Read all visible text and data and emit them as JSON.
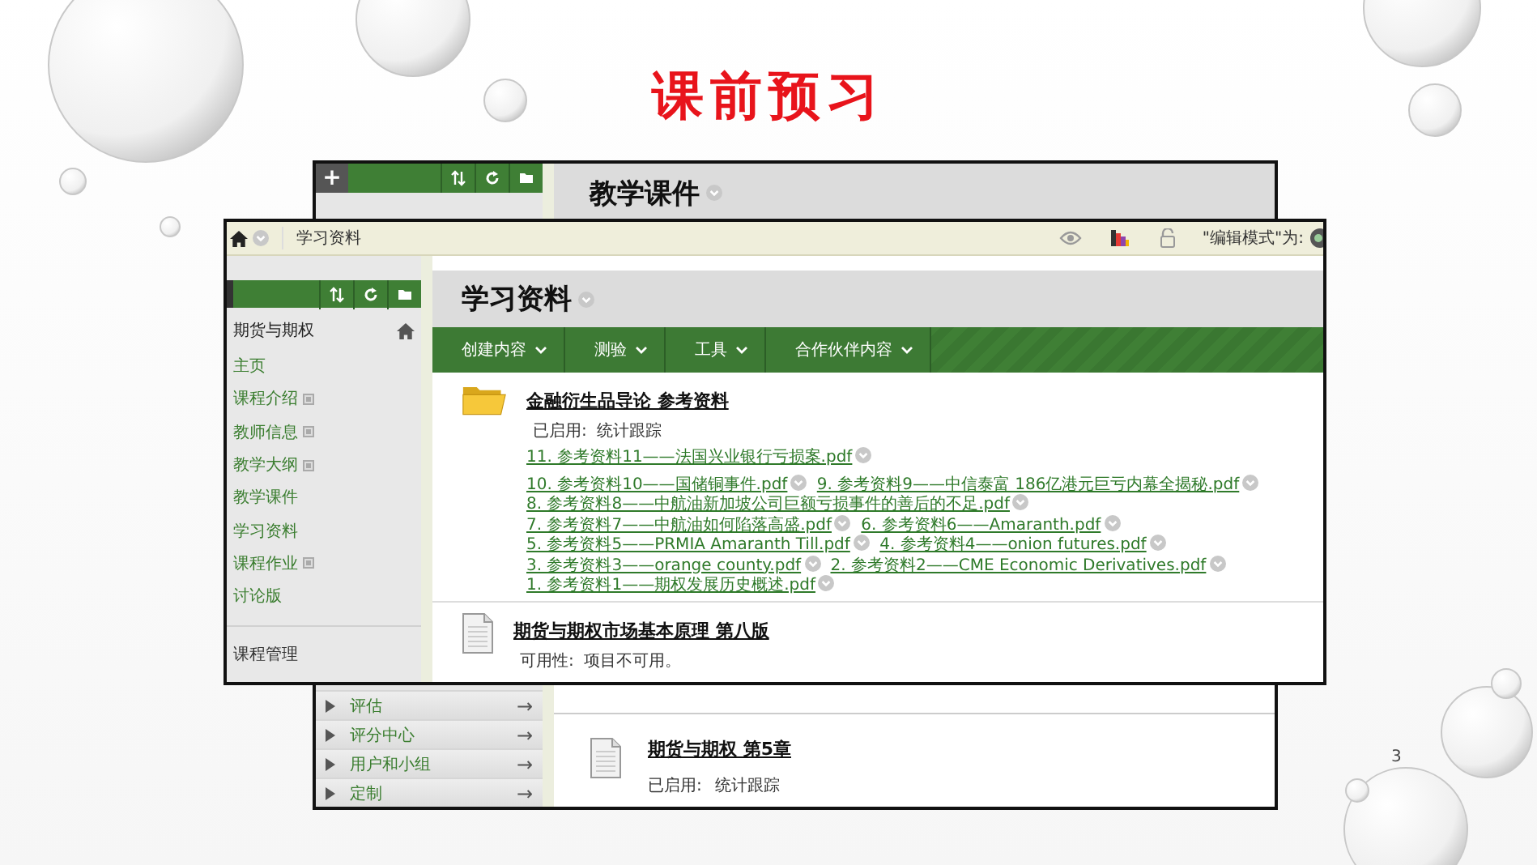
{
  "slide": {
    "title": "课前预习",
    "page_number": "3"
  },
  "back_window": {
    "add_button": "+",
    "page_title": "教学课件",
    "menu_items": [
      {
        "label": "评估",
        "arrow": "→"
      },
      {
        "label": "评分中心",
        "arrow": "→"
      },
      {
        "label": "用户和小组",
        "arrow": "→"
      },
      {
        "label": "定制",
        "arrow": "→"
      }
    ],
    "content_item": {
      "title": "期货与期权 第5章",
      "status_label": "已启用:",
      "status_value": "统计跟踪"
    }
  },
  "front_window": {
    "breadcrumb": "学习资料",
    "edit_mode_label": "\"编辑模式\"为:",
    "course_title": "期货与期权",
    "nav_items": [
      {
        "label": "主页",
        "hidden": false
      },
      {
        "label": "课程介绍",
        "hidden": true
      },
      {
        "label": "教师信息",
        "hidden": true
      },
      {
        "label": "教学大纲",
        "hidden": true
      },
      {
        "label": "教学课件",
        "hidden": false
      },
      {
        "label": "学习资料",
        "hidden": false
      },
      {
        "label": "课程作业",
        "hidden": true
      },
      {
        "label": "讨论版",
        "hidden": false
      }
    ],
    "admin_label": "课程管理",
    "page_title": "学习资料",
    "action_tabs": [
      "创建内容",
      "测验",
      "工具",
      "合作伙伴内容"
    ],
    "content_items": [
      {
        "kind": "folder",
        "title": "金融衍生品导论 参考资料",
        "status_label": "已启用:",
        "status_value": "统计跟踪",
        "link_groups": [
          [
            "11. 参考资料11——法国兴业银行亏损案.pdf"
          ],
          [
            "10. 参考资料10——国储铜事件.pdf",
            "9. 参考资料9——中信泰富 186亿港元巨亏内幕全揭秘.pdf",
            "8. 参考资料8——中航油新加坡公司巨额亏损事件的善后的不足.pdf",
            "7. 参考资料7——中航油如何陷落高盛.pdf",
            "6. 参考资料6——Amaranth.pdf",
            "5. 参考资料5——PRMIA Amaranth Till.pdf",
            "4. 参考资料4——onion futures.pdf",
            "3. 参考资料3——orange county.pdf",
            "2. 参考资料2——CME Economic Derivatives.pdf",
            "1. 参考资料1——期权发展历史概述.pdf"
          ]
        ]
      },
      {
        "kind": "document",
        "title": "期货与期权市场基本原理 第八版",
        "status_label": "可用性:",
        "status_value": "项目不可用。"
      }
    ]
  }
}
